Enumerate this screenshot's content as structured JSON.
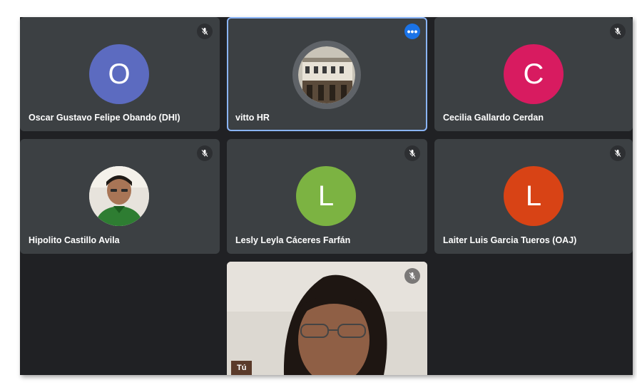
{
  "participants": [
    {
      "name": "Oscar Gustavo Felipe Obando (DHI)",
      "initial": "O",
      "color": "#5c6bc0",
      "muted": true
    },
    {
      "name": "vitto HR",
      "initial": "",
      "color": "",
      "muted": false
    },
    {
      "name": "Cecilia Gallardo Cerdan",
      "initial": "C",
      "color": "#d81b60",
      "muted": true
    },
    {
      "name": "Hipolito Castillo Avila",
      "initial": "",
      "color": "",
      "muted": true
    },
    {
      "name": "Lesly Leyla Cáceres Farfán",
      "initial": "L",
      "color": "#7cb342",
      "muted": true
    },
    {
      "name": "Laiter Luis Garcia Tueros (OAJ)",
      "initial": "L",
      "color": "#d84315",
      "muted": true
    }
  ],
  "self": {
    "label": "Tú",
    "muted": true
  },
  "more_icon": "more-options-icon",
  "mute_icon": "mic-off-icon",
  "accent": "#8ab4f8"
}
